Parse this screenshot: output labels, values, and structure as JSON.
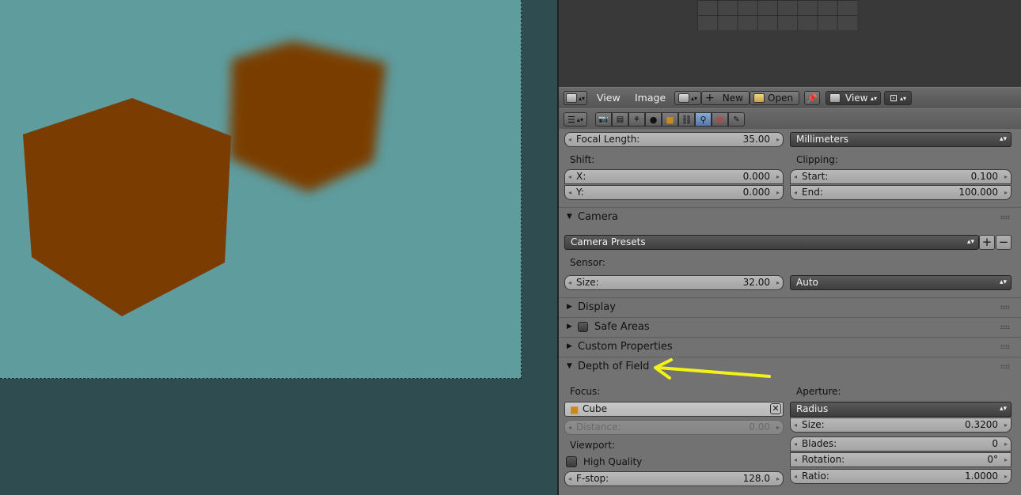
{
  "image_header": {
    "menu_view": "View",
    "menu_image": "Image",
    "new_label": "New",
    "open_label": "Open",
    "view_label": "View"
  },
  "lens": {
    "focal_length_label": "Focal Length:",
    "focal_length_value": "35.00",
    "lens_unit": "Millimeters",
    "shift_label": "Shift:",
    "shift_x_label": "X:",
    "shift_x_value": "0.000",
    "shift_y_label": "Y:",
    "shift_y_value": "0.000",
    "clipping_label": "Clipping:",
    "clip_start_label": "Start:",
    "clip_start_value": "0.100",
    "clip_end_label": "End:",
    "clip_end_value": "100.000"
  },
  "camera_panel": {
    "title": "Camera",
    "presets": "Camera Presets",
    "sensor_label": "Sensor:",
    "size_label": "Size:",
    "size_value": "32.00",
    "fit": "Auto"
  },
  "collapsed_panels": {
    "display": "Display",
    "safe_areas": "Safe Areas",
    "custom_properties": "Custom Properties"
  },
  "dof_panel": {
    "title": "Depth of Field",
    "focus_label": "Focus:",
    "focus_object": "Cube",
    "distance_label": "Distance:",
    "distance_value": "0.00",
    "viewport_label": "Viewport:",
    "high_quality_label": "High Quality",
    "fstop_label": "F-stop:",
    "fstop_value": "128.0",
    "aperture_label": "Aperture:",
    "aperture_type": "Radius",
    "ap_size_label": "Size:",
    "ap_size_value": "0.3200",
    "blades_label": "Blades:",
    "blades_value": "0",
    "rotation_label": "Rotation:",
    "rotation_value": "0°",
    "ratio_label": "Ratio:",
    "ratio_value": "1.0000"
  },
  "colors": {
    "render_bg": "#5e9c9e",
    "cube": "#7a3c00",
    "annotation_arrow": "#f2f21a"
  }
}
